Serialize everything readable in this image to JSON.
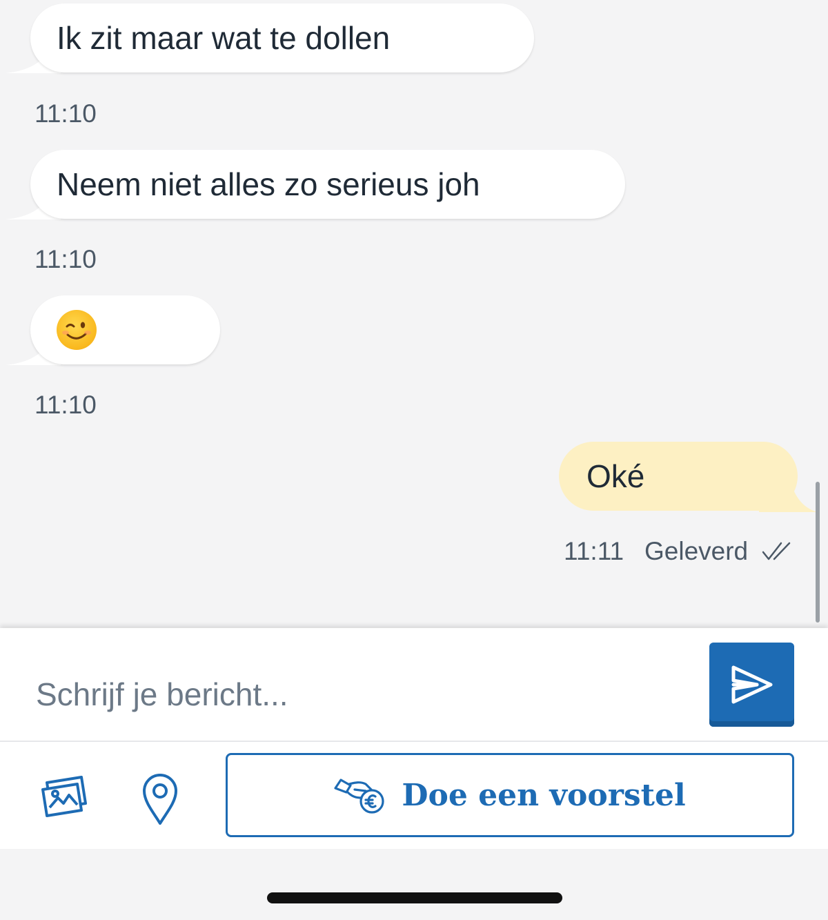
{
  "messages_in": [
    {
      "text": "Ik zit maar wat te dollen",
      "time": "11:10"
    },
    {
      "text": "Neem niet alles zo serieus joh",
      "time": "11:10"
    },
    {
      "emoji": "winking-face",
      "time": "11:10"
    }
  ],
  "message_out": {
    "text": "Oké",
    "time": "11:11",
    "status": "Geleverd"
  },
  "composer": {
    "placeholder": "Schrijf je bericht..."
  },
  "actions": {
    "offer_label": "Doe een voorstel"
  },
  "icons": [
    "image-gallery-icon",
    "location-pin-icon",
    "send-icon",
    "handshake-euro-icon",
    "double-check-icon"
  ],
  "colors": {
    "accent": "#1d6bb4",
    "outgoing_bubble": "#fdf0c3",
    "incoming_bubble": "#ffffff",
    "background": "#f4f4f5"
  }
}
